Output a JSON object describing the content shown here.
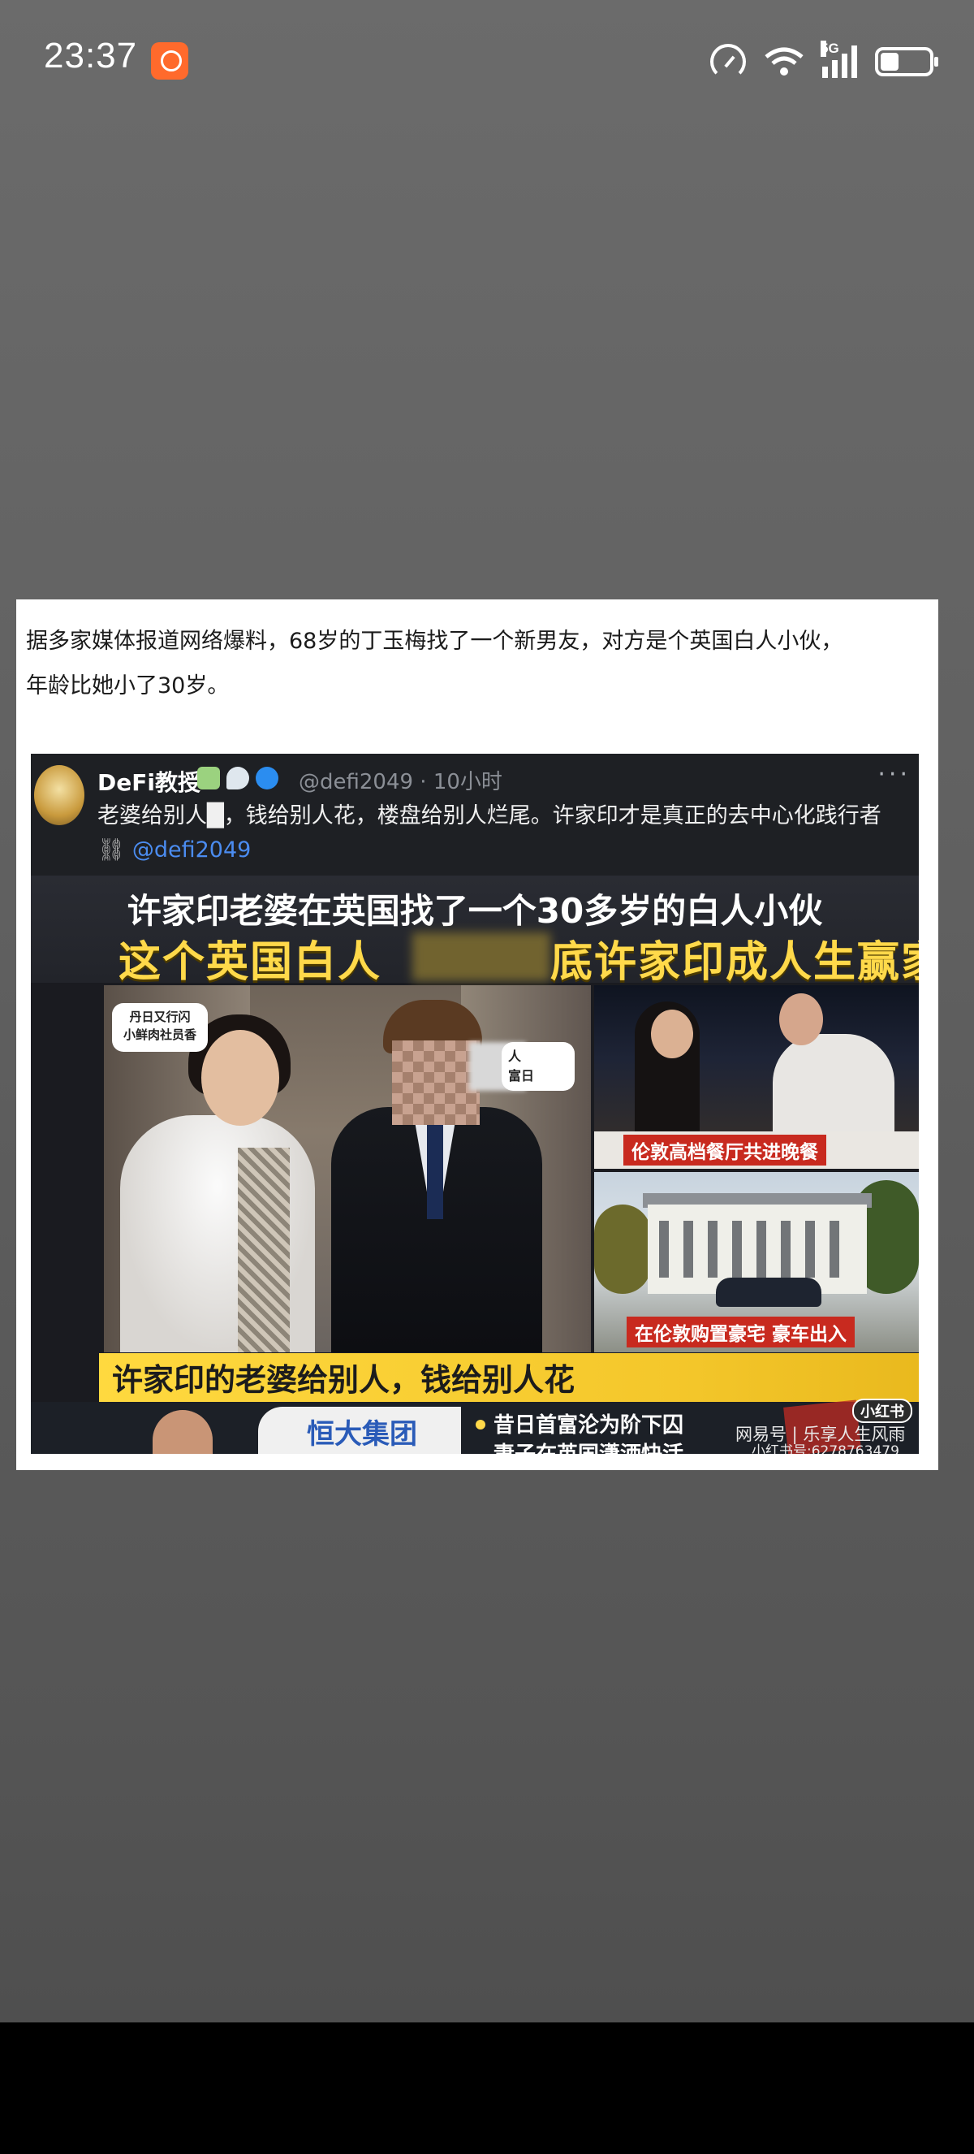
{
  "status_bar": {
    "time": "23:37",
    "app_badge_icon": "xiaohongshu-app-icon",
    "network_label": "5G",
    "icons": [
      "speedometer-icon",
      "wifi-icon",
      "5g-signal-icon",
      "battery-icon"
    ]
  },
  "post": {
    "text_line1": "据多家媒体报道网络爆料，68岁的丁玉梅找了一个新男友，对方是个英国白人小伙，",
    "text_line2": "年龄比她小了30岁。"
  },
  "image": {
    "tweet": {
      "author": "DeFi教授",
      "handle_time": "@defi2049 · 10小时",
      "text": "老婆给别人█，钱给别人花，楼盘给别人烂尾。许家印才是真正的去中心化践行者",
      "link": "@defi2049",
      "more": "···"
    },
    "headline_1": "许家印老婆在英国找了一个30多岁的白人小伙",
    "headline_2_left": "这个英国白人",
    "headline_2_right": "底许家印成人生赢家",
    "bubble_left": "丹日又行闪\n小鲜肉社员香",
    "bubble_right": "人\n富日",
    "caption_dinner": "伦敦高档餐厅共进晚餐",
    "caption_mansion": "在伦敦购置豪宅 豪车出入",
    "banner": "许家印的老婆给别人，钱给别人花",
    "logo_text": "恒大集团",
    "news_line_1": "昔日首富沦为阶下囚",
    "news_line_2": "妻子在英国潇洒快活",
    "watermark_platform": "小红书",
    "watermark_1": "网易号 | 乐享人生风雨",
    "watermark_2": "小红书号:627876347​9"
  },
  "colors": {
    "page_background": "#5f5f5f",
    "card": "#ffffff",
    "headline_yellow": "#ffd94a",
    "caption_red": "#c82a1f",
    "link_blue": "#4b8cf0"
  }
}
